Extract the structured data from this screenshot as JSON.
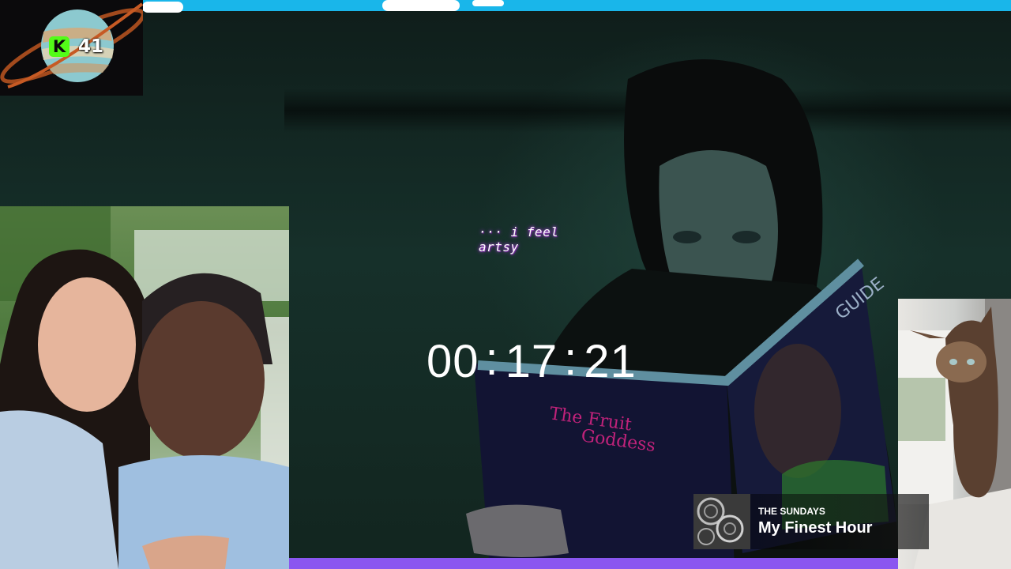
{
  "overlay": {
    "viewer_count": "41",
    "caption": "··· i feel artsy",
    "timer": {
      "hours": "00",
      "minutes": "17",
      "seconds": "21",
      "separator": ":"
    },
    "now_playing": {
      "artist": "THE SUNDAYS",
      "title": "My Finest Hour"
    },
    "progress": 1.0,
    "colors": {
      "sky": "#19b6ea",
      "progress_fill": "#8a56f0",
      "kick_green": "#53fc18",
      "caption_glow": "#9a3bc9"
    },
    "icons": {
      "platform": "kick-logo-icon",
      "badge": "planet-icon"
    }
  }
}
